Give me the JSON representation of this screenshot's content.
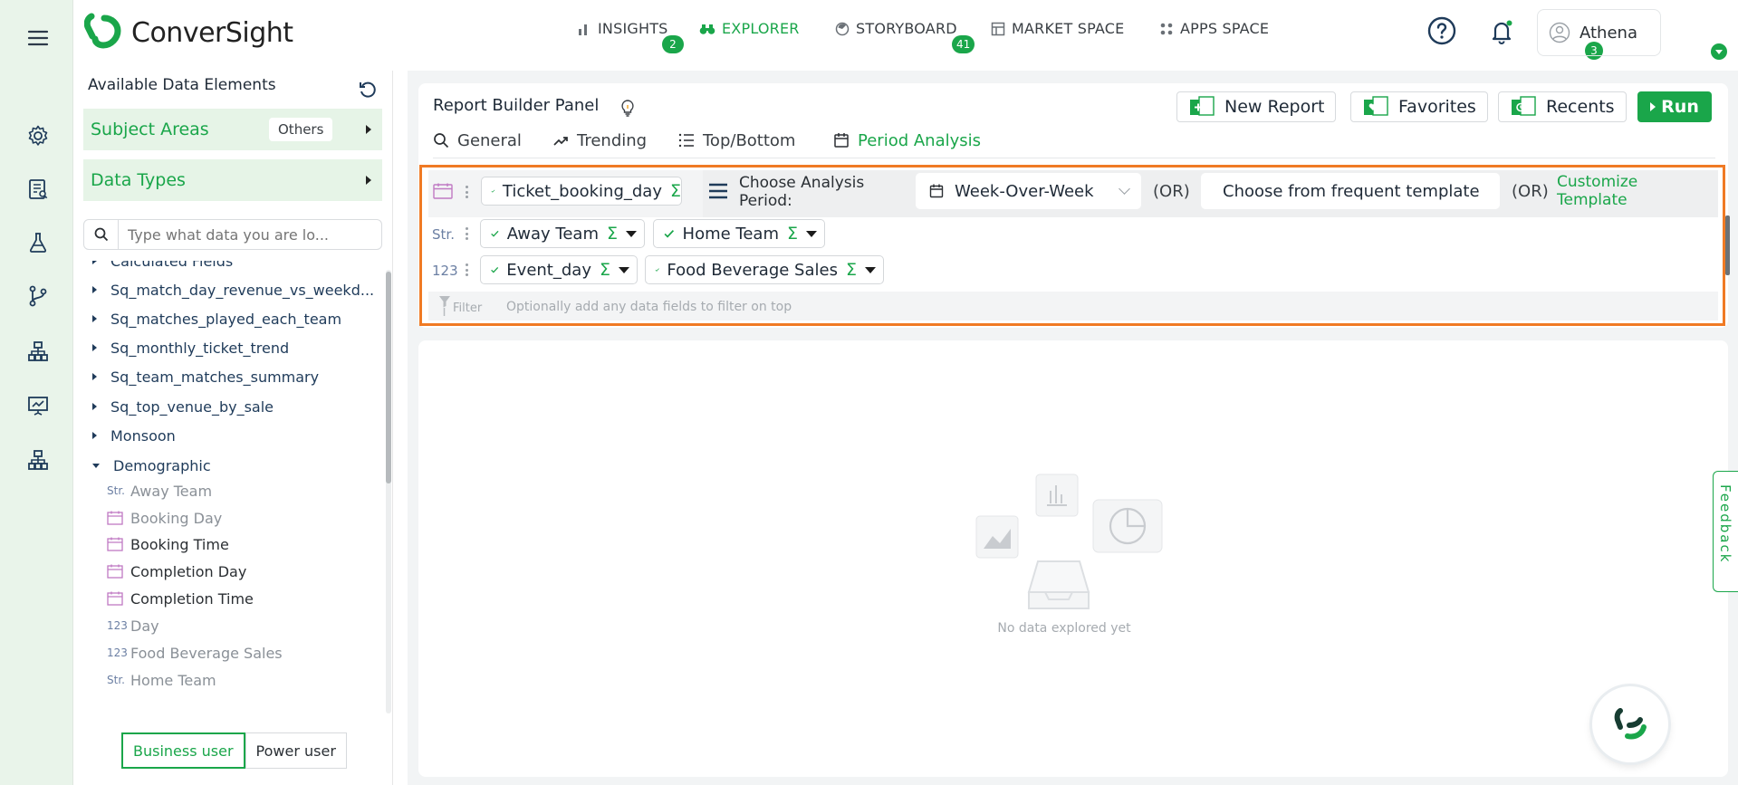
{
  "app": {
    "brand": "ConverSight",
    "accent_color": "#1aa64a",
    "highlight_color": "#f07a24"
  },
  "rail": {
    "icons": [
      "hamburger-icon",
      "gear-icon",
      "report-icon",
      "flask-icon",
      "branch-icon",
      "hierarchy-icon",
      "presentation-icon",
      "hierarchy-icon"
    ]
  },
  "nav": {
    "insights": {
      "label": "INSIGHTS",
      "badge": "2"
    },
    "explorer": {
      "label": "EXPLORER"
    },
    "storyboard": {
      "label": "STORYBOARD",
      "badge": "41"
    },
    "market": {
      "label": "MARKET SPACE"
    },
    "apps": {
      "label": "APPS SPACE"
    },
    "notifications_badge": "3",
    "user_name": "Athena"
  },
  "sidebar": {
    "title": "Available Data Elements",
    "subject_areas": {
      "label": "Subject Areas",
      "tag": "Others"
    },
    "data_types": {
      "label": "Data Types"
    },
    "search_placeholder": "Type what data you are lo...",
    "tree": [
      "Calculated Fields",
      "Sq_match_day_revenue_vs_weekd...",
      "Sq_matches_played_each_team",
      "Sq_monthly_ticket_trend",
      "Sq_team_matches_summary",
      "Sq_top_venue_by_sale",
      "Monsoon",
      "Demographic"
    ],
    "leaves": [
      {
        "type": "Str.",
        "label": "Away Team"
      },
      {
        "type": "cal",
        "label": "Booking Day"
      },
      {
        "type": "cal",
        "label": "Booking Time"
      },
      {
        "type": "cal",
        "label": "Completion Day"
      },
      {
        "type": "cal",
        "label": "Completion Time"
      },
      {
        "type": "123",
        "label": "Day"
      },
      {
        "type": "123",
        "label": "Food Beverage Sales"
      },
      {
        "type": "Str.",
        "label": "Home Team"
      }
    ],
    "modes": {
      "business": "Business user",
      "power": "Power user"
    }
  },
  "builder": {
    "title": "Report Builder Panel",
    "buttons": {
      "new_report": "New Report",
      "favorites": "Favorites",
      "recents": "Recents",
      "run": "Run"
    },
    "tabs": {
      "general": "General",
      "trending": "Trending",
      "topbottom": "Top/Bottom",
      "period": "Period Analysis"
    },
    "date_chip": "Ticket_booking_day",
    "period_label": "Choose Analysis Period:",
    "period_value": "Week-Over-Week",
    "or_label": "(OR)",
    "template_placeholder": "Choose from frequent template",
    "customize": "Customize Template",
    "str_label": "Str.",
    "num_label": "123",
    "sigma": "Σ",
    "str_chips": [
      "Away Team",
      "Home Team"
    ],
    "num_chips": [
      "Event_day",
      "Food Beverage Sales"
    ],
    "filter_label": "Filter",
    "filter_hint": "Optionally add any data fields to filter on top"
  },
  "results": {
    "empty_text": "No data explored yet"
  },
  "feedback": "Feedback"
}
